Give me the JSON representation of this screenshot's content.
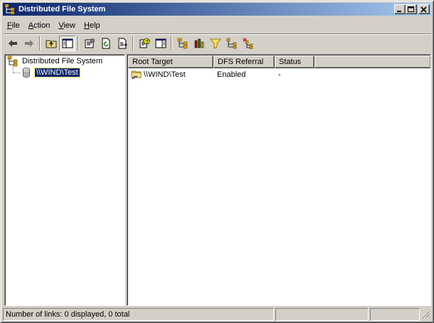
{
  "window": {
    "title": "Distributed File System",
    "app_icon": "dfs-tree-icon"
  },
  "caption_buttons": {
    "minimize": "minimize-icon",
    "maximize": "maximize-icon",
    "close": "close-icon"
  },
  "menu": {
    "items": [
      {
        "accel": "F",
        "rest": "ile"
      },
      {
        "accel": "A",
        "rest": "ction"
      },
      {
        "accel": "V",
        "rest": "iew"
      },
      {
        "accel": "H",
        "rest": "elp"
      }
    ]
  },
  "toolbar": {
    "buttons": [
      "back-arrow-icon",
      "forward-arrow-icon",
      "up-folder-icon",
      "show-hide-tree-icon",
      "properties-icon",
      "refresh-icon",
      "export-list-icon",
      "help-icon",
      "show-hide-action-pane-icon",
      "new-root-icon",
      "check-status-icon",
      "filter-icon",
      "new-link-icon",
      "delete-link-icon"
    ]
  },
  "tree": {
    "root_label": "Distributed File System",
    "root_icon": "dfs-tree-icon",
    "child_label": "\\\\WIND\\Test",
    "child_icon": "dfs-root-cylinder-icon"
  },
  "list": {
    "columns": [
      "Root Target",
      "DFS Referral",
      "Status"
    ],
    "rows": [
      {
        "root_target": "\\\\WIND\\Test",
        "dfs_referral": "Enabled",
        "status": "-",
        "icon": "shared-folder-icon"
      }
    ]
  },
  "statusbar": {
    "text": "Number of links: 0 displayed, 0 total"
  },
  "colors": {
    "title_gradient_start": "#0a246a",
    "title_gradient_end": "#a6caf0",
    "face": "#d4d0c8",
    "selection": "#0a246a"
  }
}
